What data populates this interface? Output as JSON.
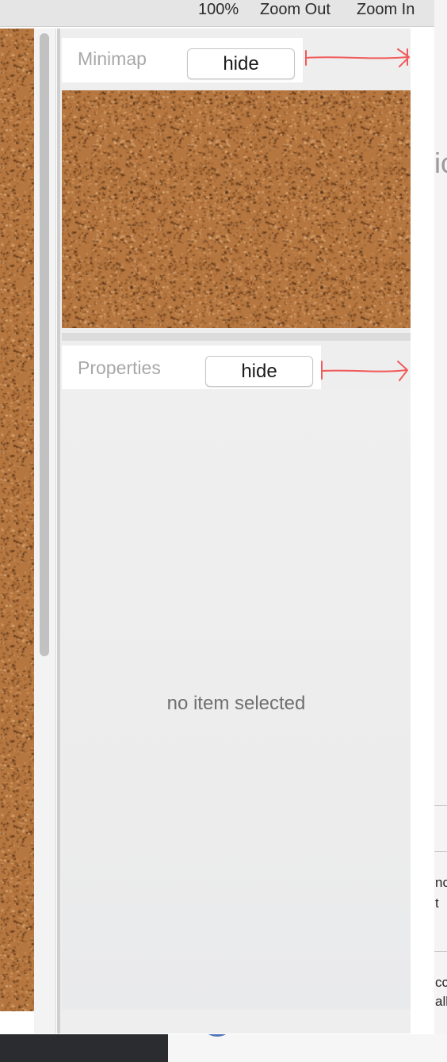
{
  "toolbar": {
    "zoom_level": "100%",
    "zoom_out_label": "Zoom Out",
    "zoom_in_label": "Zoom In"
  },
  "minimap": {
    "title": "Minimap",
    "hide_label": "hide"
  },
  "properties": {
    "title": "Properties",
    "hide_label": "hide",
    "empty_message": "no item selected"
  },
  "background_app": {
    "partial_glyph": "ic",
    "partial_lines": [
      "nc",
      "t",
      "cc",
      "all"
    ]
  },
  "colors": {
    "cork": "#b5763f",
    "annotation_arrow": "#f05a5a",
    "panel_title": "#a8a8a8"
  },
  "icons": {
    "annotation": "double-headed-arrow"
  }
}
